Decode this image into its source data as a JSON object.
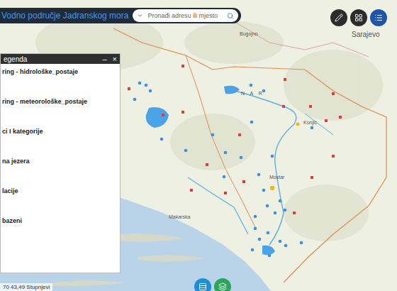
{
  "header": {
    "title": "Vodno područje Jadranskog mora",
    "search_placeholder": "Pronađi adresu ili mjesto"
  },
  "legend": {
    "title": "egenda",
    "minimize": "–",
    "close": "×",
    "items": [
      "ring - hidrološke_postaje",
      "ring - meteorološke_postaje",
      "ci I kategorije",
      "na jezera",
      "lacije",
      "bazeni"
    ]
  },
  "map_labels": [
    "Bugojno",
    "Sarajevo",
    "N A R",
    "Konjic",
    "Mostar",
    "Makarska"
  ],
  "coordinates": "70 43,49 Stupnjevi"
}
